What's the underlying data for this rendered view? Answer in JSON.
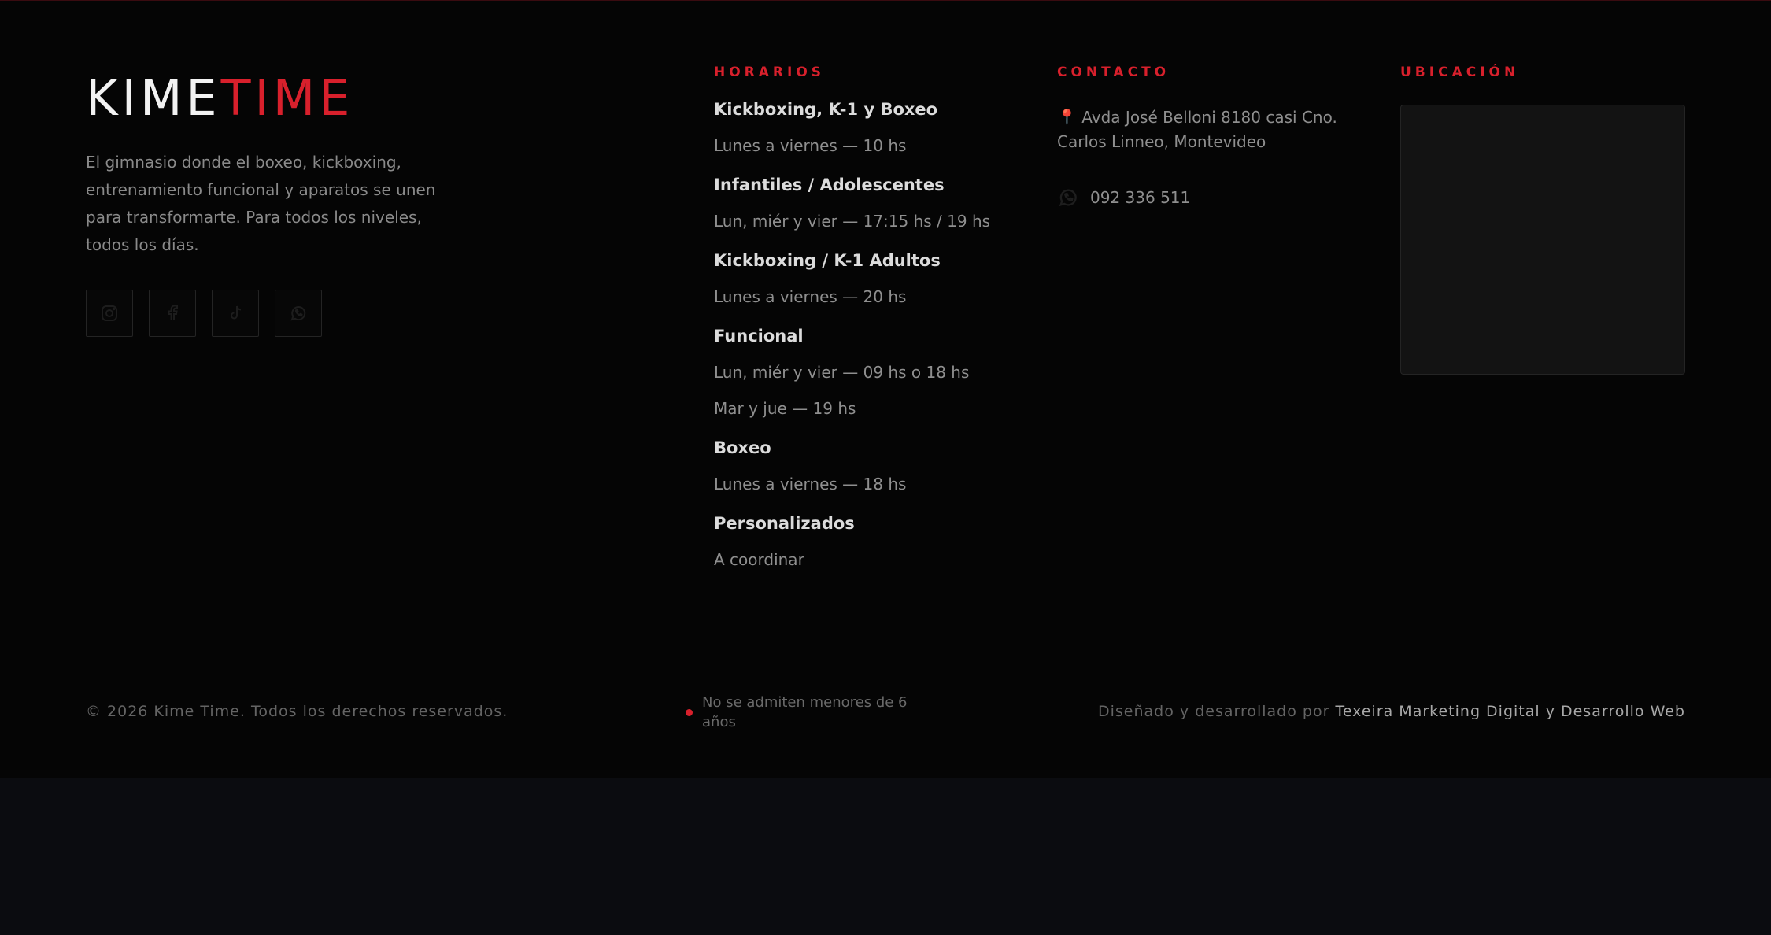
{
  "brand": {
    "logo_part1": "KIME",
    "logo_part2": "TIME",
    "tagline": "El gimnasio donde el boxeo, kickboxing, entrenamiento funcional y aparatos se unen para transformarte. Para todos los niveles, todos los días.",
    "social_icons": [
      "instagram-icon",
      "facebook-icon",
      "tiktok-icon",
      "whatsapp-icon"
    ]
  },
  "horarios": {
    "heading": "HORARIOS",
    "groups": [
      {
        "title": "Kickboxing, K-1 y Boxeo",
        "lines": [
          "Lunes a viernes — 10 hs"
        ]
      },
      {
        "title": "Infantiles / Adolescentes",
        "lines": [
          "Lun, miér y vier — 17:15 hs / 19 hs"
        ]
      },
      {
        "title": "Kickboxing / K-1 Adultos",
        "lines": [
          "Lunes a viernes — 20 hs"
        ]
      },
      {
        "title": "Funcional",
        "lines": [
          "Lun, miér y vier — 09 hs o 18 hs",
          "Mar y jue — 19 hs"
        ]
      },
      {
        "title": "Boxeo",
        "lines": [
          "Lunes a viernes — 18 hs"
        ]
      },
      {
        "title": "Personalizados",
        "lines": [
          "A coordinar"
        ]
      }
    ]
  },
  "contacto": {
    "heading": "CONTACTO",
    "address_icon": "📍",
    "address": "Avda José Belloni 8180 casi Cno. Carlos Linneo, Montevideo",
    "phone": "092 336 511"
  },
  "ubicacion": {
    "heading": "UBICACIÓN"
  },
  "bottom": {
    "copyright": "© 2026 Kime Time. Todos los derechos reservados.",
    "notice": "No se admiten menores de 6 años",
    "credits_prefix": "Diseñado y desarrollado por",
    "credits_link": "Texeira Marketing Digital y Desarrollo Web"
  },
  "colors": {
    "accent": "#d8202c",
    "background": "#050505",
    "page_below": "#0b0c10"
  }
}
